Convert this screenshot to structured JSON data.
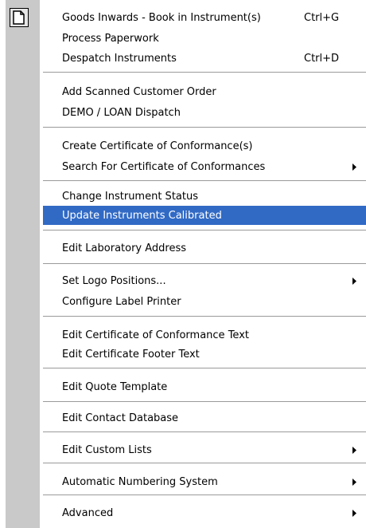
{
  "menu": {
    "icon": "document-icon",
    "highlight_color": "#316ac5",
    "items": [
      {
        "label": "Goods Inwards - Book in Instrument(s)",
        "shortcut": "Ctrl+G"
      },
      {
        "label": "Process Paperwork",
        "shortcut": ""
      },
      {
        "label": "Despatch Instruments",
        "shortcut": "Ctrl+D"
      },
      {
        "label": "Add Scanned Customer Order",
        "shortcut": ""
      },
      {
        "label": "DEMO / LOAN Dispatch",
        "shortcut": ""
      },
      {
        "label": "Create Certificate of Conformance(s)",
        "shortcut": ""
      },
      {
        "label": "Search For Certificate of Conformances",
        "shortcut": "",
        "submenu": true
      },
      {
        "label": "Change Instrument Status",
        "shortcut": ""
      },
      {
        "label": "Update Instruments Calibrated",
        "shortcut": "",
        "highlighted": true
      },
      {
        "label": "Edit Laboratory Address",
        "shortcut": ""
      },
      {
        "label": "Set Logo Positions...",
        "shortcut": "",
        "submenu": true
      },
      {
        "label": "Configure Label Printer",
        "shortcut": ""
      },
      {
        "label": "Edit Certificate of Conformance Text",
        "shortcut": ""
      },
      {
        "label": "Edit Certificate Footer Text",
        "shortcut": ""
      },
      {
        "label": "Edit Quote Template",
        "shortcut": ""
      },
      {
        "label": "Edit Contact Database",
        "shortcut": ""
      },
      {
        "label": "Edit Custom Lists",
        "shortcut": "",
        "submenu": true
      },
      {
        "label": "Automatic Numbering System",
        "shortcut": "",
        "submenu": true
      },
      {
        "label": "Advanced",
        "shortcut": "",
        "submenu": true
      }
    ]
  }
}
